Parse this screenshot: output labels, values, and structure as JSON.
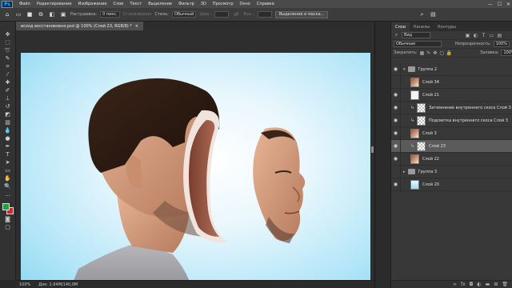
{
  "menu": {
    "logo": "Ps",
    "items": [
      "Файл",
      "Редактирование",
      "Изображение",
      "Слои",
      "Текст",
      "Выделение",
      "Фильтр",
      "3D",
      "Просмотр",
      "Окно",
      "Справка"
    ]
  },
  "window_controls": {
    "minimize": "—",
    "maximize": "☐",
    "close": "✕"
  },
  "options_bar": {
    "feather_label": "Растушевка:",
    "feather_value": "0 пикс.",
    "smoothing_label": "Сглаживание",
    "style_label": "Стиль:",
    "style_value": "Обычный",
    "width_label": "Шир.:",
    "height_label": "Выс.:",
    "select_mask_button": "Выделение и маска..."
  },
  "document_tab": {
    "title": "исход восстановлено.psd @ 100% (Слой 23, RGB/8) *",
    "close": "×"
  },
  "status_bar": {
    "zoom": "100%",
    "doc_info": "Док: 2,64M/140,0M"
  },
  "colors": {
    "foreground": "#1ea23c",
    "background": "#d6252a",
    "accent": "#31a8ff"
  },
  "layers_panel": {
    "tabs": [
      "Слои",
      "Каналы",
      "Контуры"
    ],
    "kind_filter": "Вид",
    "blend_mode": "Обычные",
    "opacity_label": "Непрозрачность:",
    "opacity_value": "100%",
    "lock_label": "Закрепить:",
    "fill_label": "Заливка:",
    "fill_value": "100%",
    "layers": [
      {
        "name": "Группа 2",
        "type": "group",
        "visible": true,
        "selected": false
      },
      {
        "name": "Слой 34",
        "type": "layer",
        "visible": false,
        "selected": false,
        "thumb": "face"
      },
      {
        "name": "Слой 21",
        "type": "layer",
        "visible": true,
        "selected": false,
        "thumb": "white"
      },
      {
        "name": "Затемнение внутреннего скоса Слой 3",
        "type": "clip",
        "visible": true,
        "selected": false,
        "thumb": "check"
      },
      {
        "name": "Подсветка внутреннего скоса Слой 3",
        "type": "clip",
        "visible": true,
        "selected": false,
        "thumb": "check"
      },
      {
        "name": "Слой 3",
        "type": "layer",
        "visible": true,
        "selected": false,
        "thumb": "face"
      },
      {
        "name": "Слой 23",
        "type": "clip",
        "visible": true,
        "selected": true,
        "thumb": "check"
      },
      {
        "name": "Слой 22",
        "type": "layer",
        "visible": true,
        "selected": false,
        "thumb": "face"
      },
      {
        "name": "Группа 3",
        "type": "group",
        "visible": false,
        "selected": false
      },
      {
        "name": "Слой 20",
        "type": "layer",
        "visible": true,
        "selected": false,
        "thumb": "blue"
      }
    ]
  }
}
